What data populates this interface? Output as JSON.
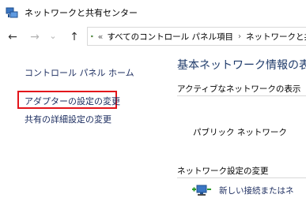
{
  "window": {
    "title": "ネットワークと共有センター"
  },
  "nav": {
    "back_glyph": "←",
    "forward_glyph": "→",
    "dropdown_glyph": "⌄",
    "up_glyph": "↑"
  },
  "address": {
    "chevron": "«",
    "crumbs": [
      "すべてのコントロール パネル項目",
      "ネットワークと共"
    ],
    "separator": "›"
  },
  "sidebar": {
    "items": [
      {
        "label": "コントロール パネル ホーム"
      },
      {
        "label": "アダプターの設定の変更",
        "highlighted": true
      },
      {
        "label": "共有の詳細設定の変更"
      }
    ]
  },
  "main": {
    "heading": "基本ネットワーク情報の表",
    "active_networks_label": "アクティブなネットワークの表示",
    "network_name": "パブリック ネットワーク",
    "change_settings_label": "ネットワーク設定の変更",
    "new_connection_label": "新しい接続またはネ"
  },
  "colors": {
    "link": "#1a2b5e",
    "heading": "#1e3a6a",
    "highlight_border": "#e3141b"
  },
  "icons": [
    "network-sharing-icon",
    "control-panel-icon",
    "new-connection-icon"
  ]
}
